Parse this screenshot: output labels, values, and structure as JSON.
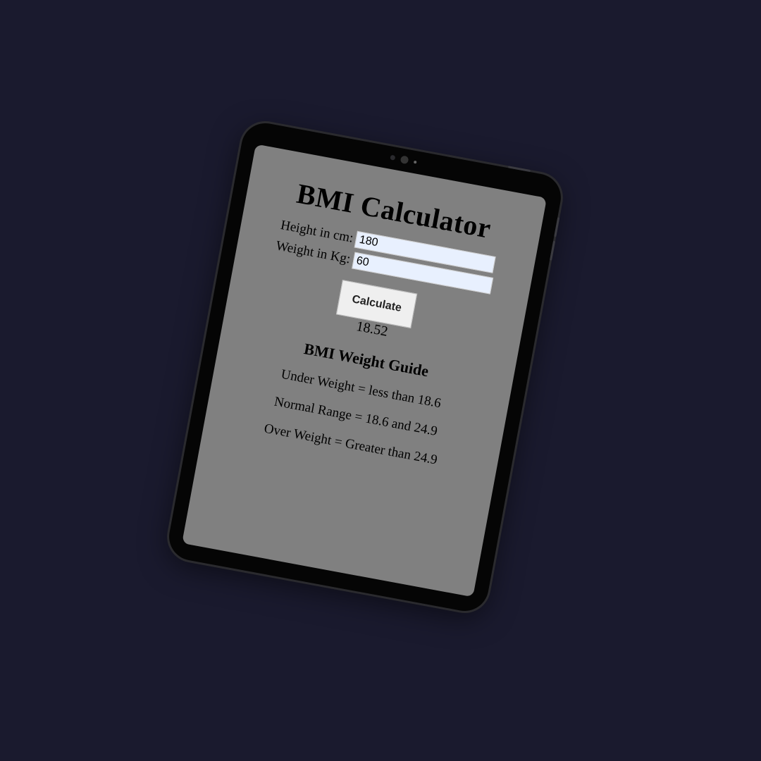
{
  "app": {
    "title": "BMI Calculator"
  },
  "form": {
    "height_label": "Height in cm:",
    "height_value": "180",
    "weight_label": "Weight in Kg:",
    "weight_value": "60",
    "calculate_label": "Calculate"
  },
  "result": {
    "value": "18.52"
  },
  "guide": {
    "title": "BMI Weight Guide",
    "lines": [
      "Under Weight = less than 18.6",
      "Normal Range = 18.6 and 24.9",
      "Over Weight = Greater than 24.9"
    ]
  },
  "colors": {
    "background": "#1a1a2e",
    "screen": "#808080",
    "input_bg": "#e8f0fe"
  }
}
